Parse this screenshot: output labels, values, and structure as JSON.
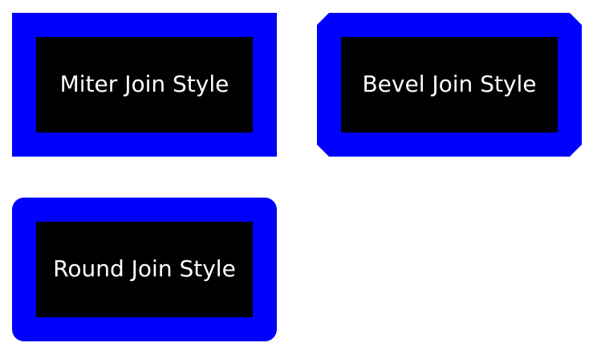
{
  "colors": {
    "background": "#ffffff",
    "stroke": "#0000ff",
    "fill": "#000000",
    "text": "#ffffff"
  },
  "shapes": [
    {
      "id": "miter",
      "join_style": "miter",
      "label": "Miter Join Style"
    },
    {
      "id": "bevel",
      "join_style": "bevel",
      "label": "Bevel Join Style"
    },
    {
      "id": "round",
      "join_style": "round",
      "label": "Round Join Style"
    }
  ]
}
